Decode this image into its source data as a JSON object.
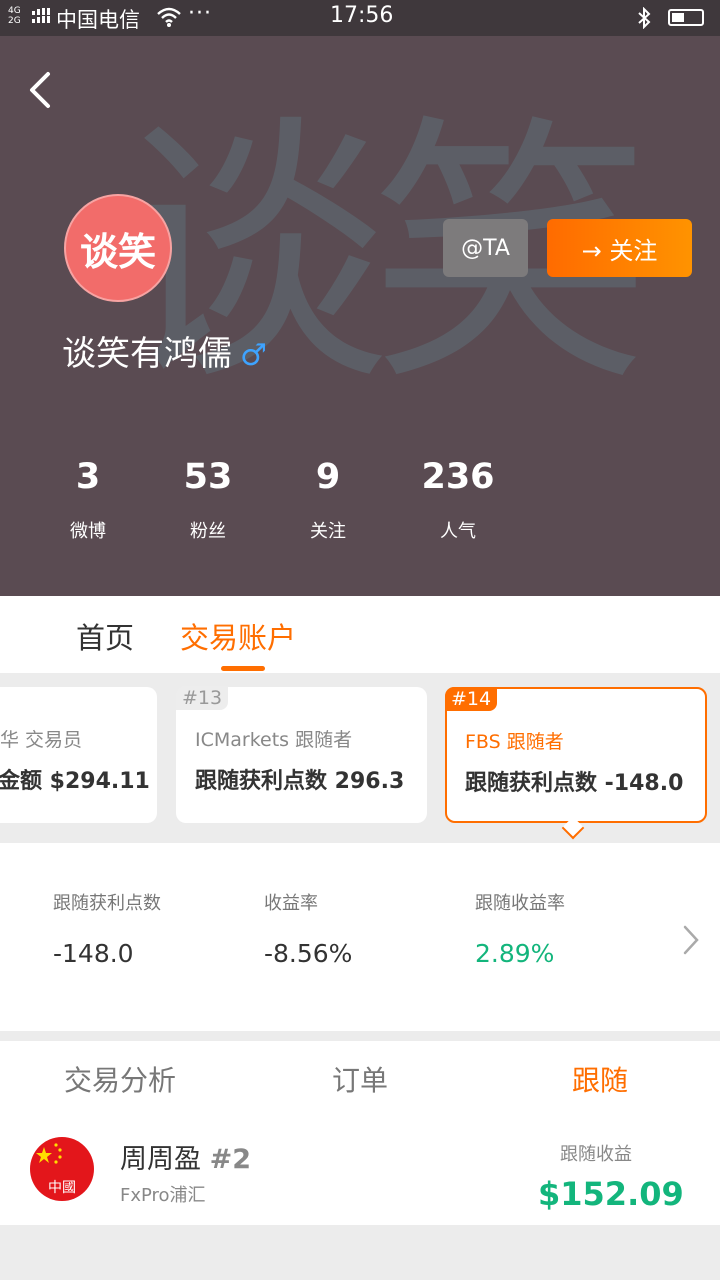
{
  "status_bar": {
    "net_4g": "4G",
    "net_2g": "2G",
    "carrier": "中国电信",
    "more": "···",
    "time": "17:56"
  },
  "profile": {
    "avatar_text": "谈笑",
    "watermark_text": "谈笑",
    "name": "谈笑有鸿儒",
    "gender_symbol": "♂",
    "at_label": "@TA",
    "follow_label": "→ 关注",
    "stats": [
      {
        "value": "3",
        "label": "微博"
      },
      {
        "value": "53",
        "label": "粉丝"
      },
      {
        "value": "9",
        "label": "关注"
      },
      {
        "value": "236",
        "label": "人气"
      }
    ]
  },
  "main_tabs": [
    {
      "label": "首页"
    },
    {
      "label": "交易账户",
      "active": true
    }
  ],
  "accounts": [
    {
      "sub": "华 交易员",
      "main": "金额 $294.11"
    },
    {
      "tag": "#13",
      "sub": "ICMarkets 跟随者",
      "main": "跟随获利点数 296.3"
    },
    {
      "tag": "#14",
      "sub": "FBS 跟随者",
      "main": "跟随获利点数 -148.0",
      "selected": true
    }
  ],
  "account_stats": [
    {
      "label": "跟随获利点数",
      "value": "-148.0",
      "color": "#333333"
    },
    {
      "label": "收益率",
      "value": "-8.56%",
      "color": "#333333"
    },
    {
      "label": "跟随收益率",
      "value": "2.89%",
      "color": "#13b57c"
    }
  ],
  "sub_tabs": [
    {
      "label": "交易分析"
    },
    {
      "label": "订单"
    },
    {
      "label": "跟随",
      "active": true
    }
  ],
  "follow_item": {
    "flag_text": "中國",
    "name": "周周盈",
    "number": "#2",
    "broker": "FxPro浦汇",
    "profit_label": "跟随收益",
    "profit_value": "$152.09"
  },
  "colors": {
    "accent": "#ff6e00",
    "header_bg": "#5a4b52",
    "positive": "#13b57c"
  }
}
